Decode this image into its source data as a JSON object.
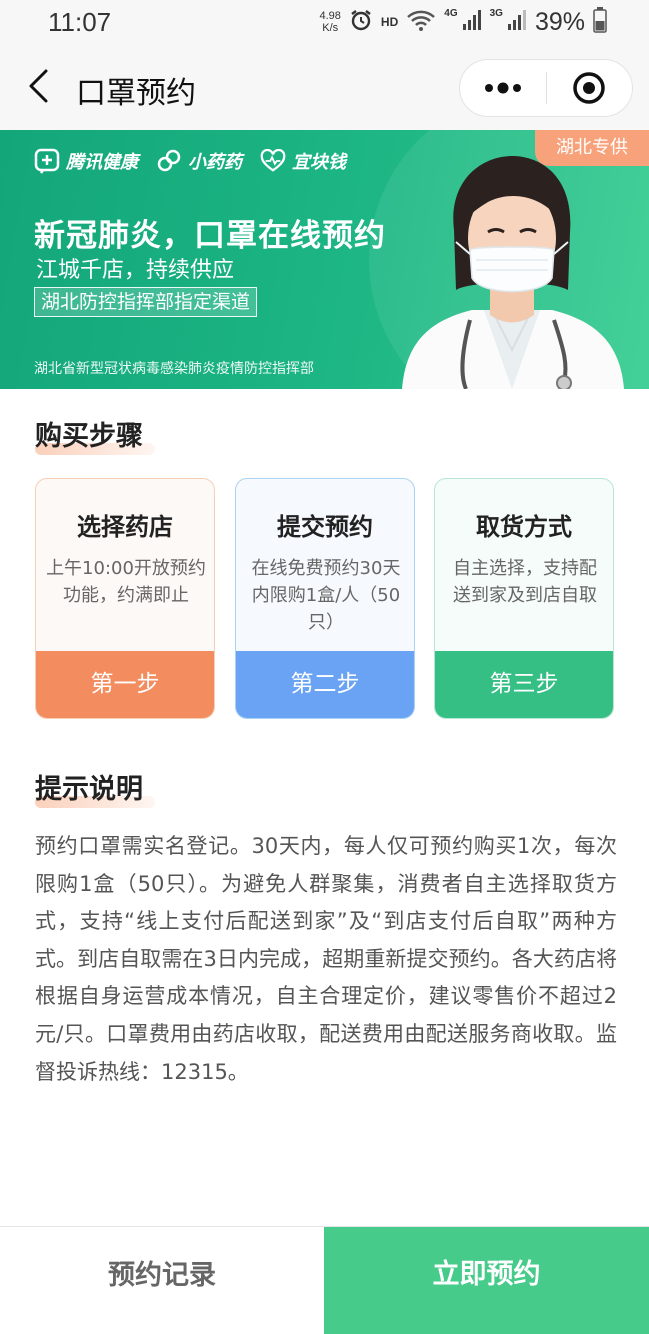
{
  "status_bar": {
    "time": "11:07",
    "net_speed_value": "4.98",
    "net_speed_unit": "K/s",
    "hd": "HD",
    "signal_1": "4G",
    "signal_2": "3G",
    "battery": "39%"
  },
  "nav": {
    "title": "口罩预约",
    "icons": [
      "back-arrow-icon",
      "more-dots-icon",
      "close-target-icon"
    ]
  },
  "banner": {
    "brands": [
      "腾讯健康",
      "小药药",
      "宜块钱"
    ],
    "badge": "湖北专供",
    "title": "新冠肺炎，口罩在线预约",
    "subtitle": "江城千店，持续供应",
    "tag": "湖北防控指挥部指定渠道",
    "footer": "湖北省新型冠状病毒感染肺炎疫情防控指挥部"
  },
  "steps_section": {
    "title": "购买步骤",
    "steps": [
      {
        "name": "选择药店",
        "desc": "上午10:00开放预约功能，约满即止",
        "label": "第一步",
        "color": "#f38d5f"
      },
      {
        "name": "提交预约",
        "desc": "在线免费预约30天内限购1盒/人（50只）",
        "label": "第二步",
        "color": "#6aa3f4"
      },
      {
        "name": "取货方式",
        "desc": "自主选择，支持配送到家及到店自取",
        "label": "第三步",
        "color": "#36bf85"
      }
    ]
  },
  "notes_section": {
    "title": "提示说明",
    "body": "预约口罩需实名登记。30天内，每人仅可预约购买1次，每次限购1盒（50只）。为避免人群聚集，消费者自主选择取货方式，支持“线上支付后配送到家”及“到店支付后自取”两种方式。到店自取需在3日内完成，超期重新提交预约。各大药店将根据自身运营成本情况，自主合理定价，建议零售价不超过2元/只。口罩费用由药店收取，配送费用由配送服务商收取。监督投诉热线：12315。"
  },
  "bottom_bar": {
    "records_label": "预约记录",
    "reserve_label": "立即预约",
    "accent": "#46cb8a"
  }
}
